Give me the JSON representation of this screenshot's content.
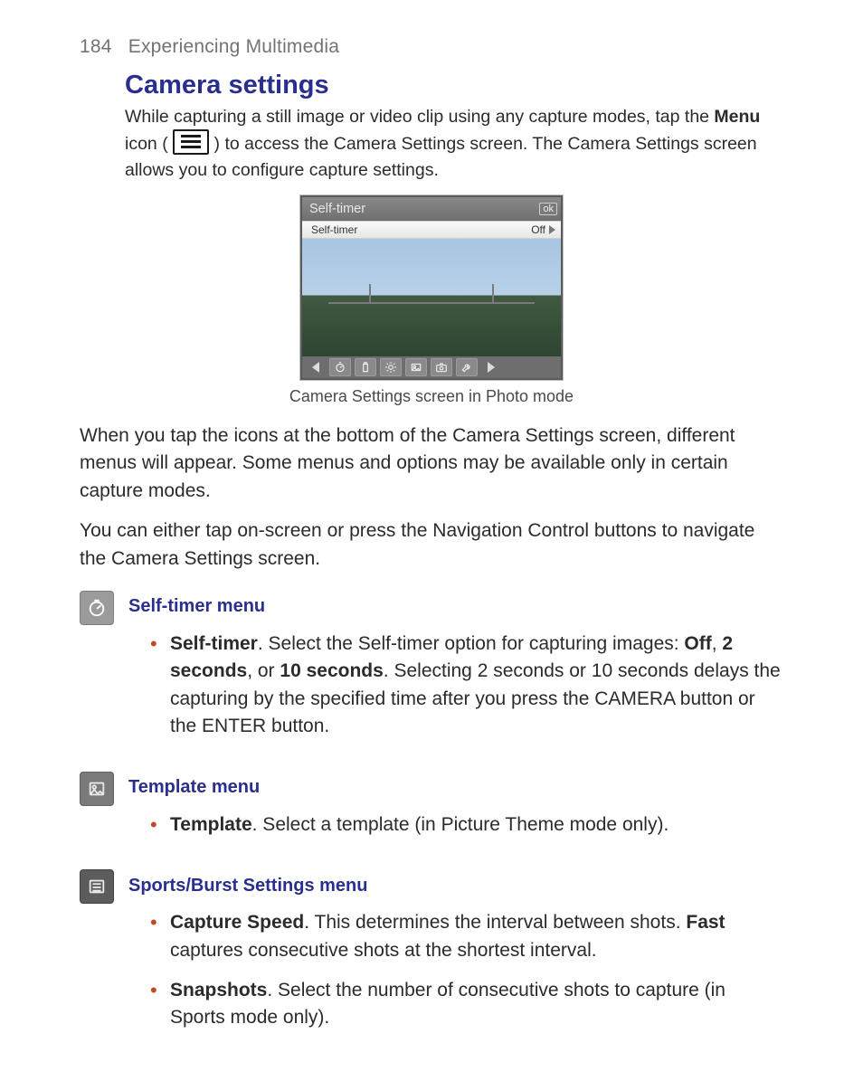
{
  "runhead": {
    "page": "184",
    "title": "Experiencing Multimedia"
  },
  "heading": "Camera settings",
  "intro": {
    "a": "While capturing a still image or video clip using any capture modes, tap the ",
    "menu_word": "Menu",
    "b": " icon ( ",
    "c": " ) to access the Camera Settings screen. The Camera Settings screen allows you to configure capture settings."
  },
  "screenshot": {
    "title": "Self-timer",
    "ok": "ok",
    "row_label": "Self-timer",
    "row_value": "Off"
  },
  "caption": "Camera Settings screen in Photo mode",
  "para1": "When you tap the icons at the bottom of the Camera Settings screen, different menus will appear. Some menus and options may be available only in certain capture modes.",
  "para2": "You can either tap on-screen or press the Navigation Control buttons to navigate the Camera Settings screen.",
  "menus": {
    "selftimer": {
      "title": "Self-timer menu",
      "item_label": "Self-timer",
      "t1": ". Select the Self-timer option for capturing images: ",
      "off": "Off",
      "t2": ", ",
      "two": "2 seconds",
      "t3": ", or ",
      "ten": "10 seconds",
      "t4": ". Selecting 2 seconds or 10 seconds delays the capturing by the specified time after you press the CAMERA button or the ENTER button."
    },
    "template": {
      "title": "Template menu",
      "item_label": "Template",
      "t1": ". Select a template (in Picture Theme mode only)."
    },
    "sports": {
      "title": "Sports/Burst Settings menu",
      "cs_label": "Capture Speed",
      "cs_t1": ". This determines the interval between shots. ",
      "cs_fast": "Fast",
      "cs_t2": " captures consecutive shots at the shortest interval.",
      "sn_label": "Snapshots",
      "sn_t1": ". Select the number of consecutive shots to capture (in Sports mode only)."
    }
  }
}
